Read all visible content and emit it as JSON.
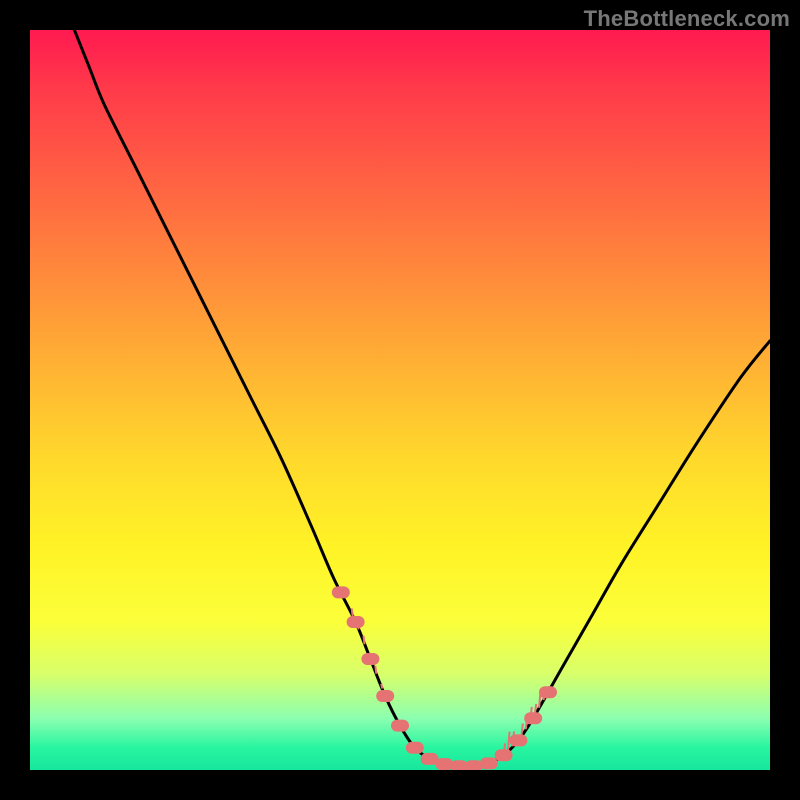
{
  "watermark": "TheBottleneck.com",
  "colors": {
    "dot": "#e57373",
    "curve": "#000000"
  },
  "chart_data": {
    "type": "line",
    "title": "",
    "xlabel": "",
    "ylabel": "",
    "xlim": [
      0,
      100
    ],
    "ylim": [
      0,
      100
    ],
    "series": [
      {
        "name": "curve",
        "x": [
          6,
          8,
          10,
          14,
          18,
          22,
          26,
          30,
          34,
          38,
          41,
          44,
          46,
          48,
          50,
          52,
          54,
          56,
          58,
          60,
          62,
          64,
          66,
          68,
          72,
          76,
          80,
          85,
          90,
          96,
          100
        ],
        "y": [
          100,
          95,
          90,
          82,
          74,
          66,
          58,
          50,
          42,
          33,
          26,
          20,
          15,
          10,
          6,
          3,
          1.5,
          0.8,
          0.5,
          0.5,
          0.9,
          2,
          4,
          7,
          14,
          21,
          28,
          36,
          44,
          53,
          58
        ]
      }
    ],
    "markers": {
      "left_wall_x": 44,
      "right_wall_x": 68,
      "floor_y": 0.6,
      "floor_x_range": [
        50,
        64
      ],
      "dot_x_positions_left": [
        42,
        44,
        46,
        48,
        50
      ],
      "dot_x_positions_floor": [
        52,
        54,
        56,
        58,
        60,
        62
      ],
      "dot_x_positions_right": [
        64,
        66,
        68,
        70
      ]
    }
  }
}
